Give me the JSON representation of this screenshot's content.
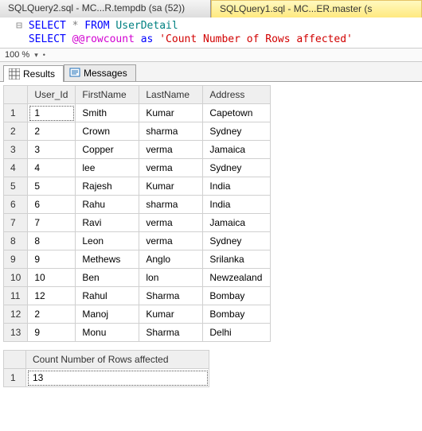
{
  "tabs": {
    "inactive": "SQLQuery2.sql - MC...R.tempdb (sa (52))",
    "active": "SQLQuery1.sql - MC...ER.master (s"
  },
  "editor": {
    "line1": {
      "kw1": "SELECT",
      "star": " * ",
      "kw2": "FROM",
      "ident": " UserDetail"
    },
    "line2": {
      "kw1": "SELECT ",
      "func": "@@rowcount",
      "as": " as ",
      "str": "'Count Number of Rows affected'"
    }
  },
  "zoom": {
    "value": "100 %"
  },
  "resultTabs": {
    "results": "Results",
    "messages": "Messages"
  },
  "grid1": {
    "headers": [
      "User_Id",
      "FirstName",
      "LastName",
      "Address"
    ],
    "rows": [
      [
        "1",
        "Smith",
        "Kumar",
        "Capetown"
      ],
      [
        "2",
        "Crown",
        "sharma",
        "Sydney"
      ],
      [
        "3",
        "Copper",
        "verma",
        "Jamaica"
      ],
      [
        "4",
        "lee",
        "verma",
        "Sydney"
      ],
      [
        "5",
        "Rajesh",
        "Kumar",
        "India"
      ],
      [
        "6",
        "Rahu",
        "sharma",
        "India"
      ],
      [
        "7",
        "Ravi",
        "verma",
        "Jamaica"
      ],
      [
        "8",
        "Leon",
        "verma",
        "Sydney"
      ],
      [
        "9",
        "Methews",
        "Anglo",
        "Srilanka"
      ],
      [
        "10",
        "Ben",
        "lon",
        "Newzealand"
      ],
      [
        "12",
        "Rahul",
        "Sharma",
        "Bombay"
      ],
      [
        "2",
        "Manoj",
        "Kumar",
        "Bombay"
      ],
      [
        "9",
        "Monu",
        "Sharma",
        "Delhi"
      ]
    ]
  },
  "grid2": {
    "header": "Count Number of Rows affected",
    "rownum": "1",
    "value": "13"
  }
}
